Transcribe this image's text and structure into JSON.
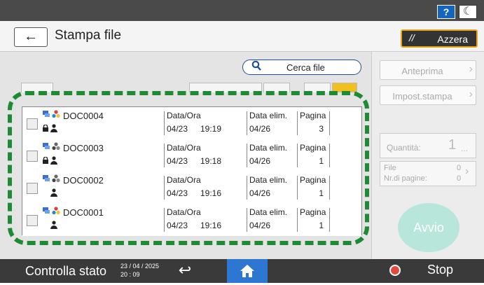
{
  "topbar": {
    "help_icon_label": "?",
    "night_icon_label": "☾"
  },
  "header": {
    "title": "Stampa file",
    "reset_label": "Azzera"
  },
  "search": {
    "label": "Cerca file"
  },
  "columns": {
    "datetime": "Data/Ora",
    "delete_date": "Data elim.",
    "pages": "Pagina"
  },
  "files": [
    {
      "name": "DOC0004",
      "date": "04/23",
      "time": "19:19",
      "delete_date": "04/26",
      "pages": "3",
      "locked": true,
      "color_icon": "color"
    },
    {
      "name": "DOC0003",
      "date": "04/23",
      "time": "19:18",
      "delete_date": "04/26",
      "pages": "1",
      "locked": true,
      "color_icon": "mono"
    },
    {
      "name": "DOC0002",
      "date": "04/23",
      "time": "19:16",
      "delete_date": "04/26",
      "pages": "1",
      "locked": false,
      "color_icon": "mono"
    },
    {
      "name": "DOC0001",
      "date": "04/23",
      "time": "19:16",
      "delete_date": "04/26",
      "pages": "1",
      "locked": false,
      "color_icon": "color"
    }
  ],
  "right_panel": {
    "preview_label": "Anteprima",
    "settings_label": "Impost.stampa",
    "quantity_label": "Quantità:",
    "quantity_value": "1",
    "quantity_more": "...",
    "files_label": "File",
    "files_value": "0",
    "pages_label": "Nr.di pagine:",
    "pages_value": "0",
    "start_label": "Avvio"
  },
  "bottombar": {
    "status_label": "Controlla stato",
    "date": "23 / 04 / 2025",
    "time": "20 : 09",
    "stop_label": "Stop"
  },
  "colors": {
    "accent_blue": "#1d4e9a",
    "dash_green": "#1e8b34",
    "reset_border": "#e6a417",
    "home_blue": "#2d76d2",
    "start_teal": "#b9e6db"
  }
}
